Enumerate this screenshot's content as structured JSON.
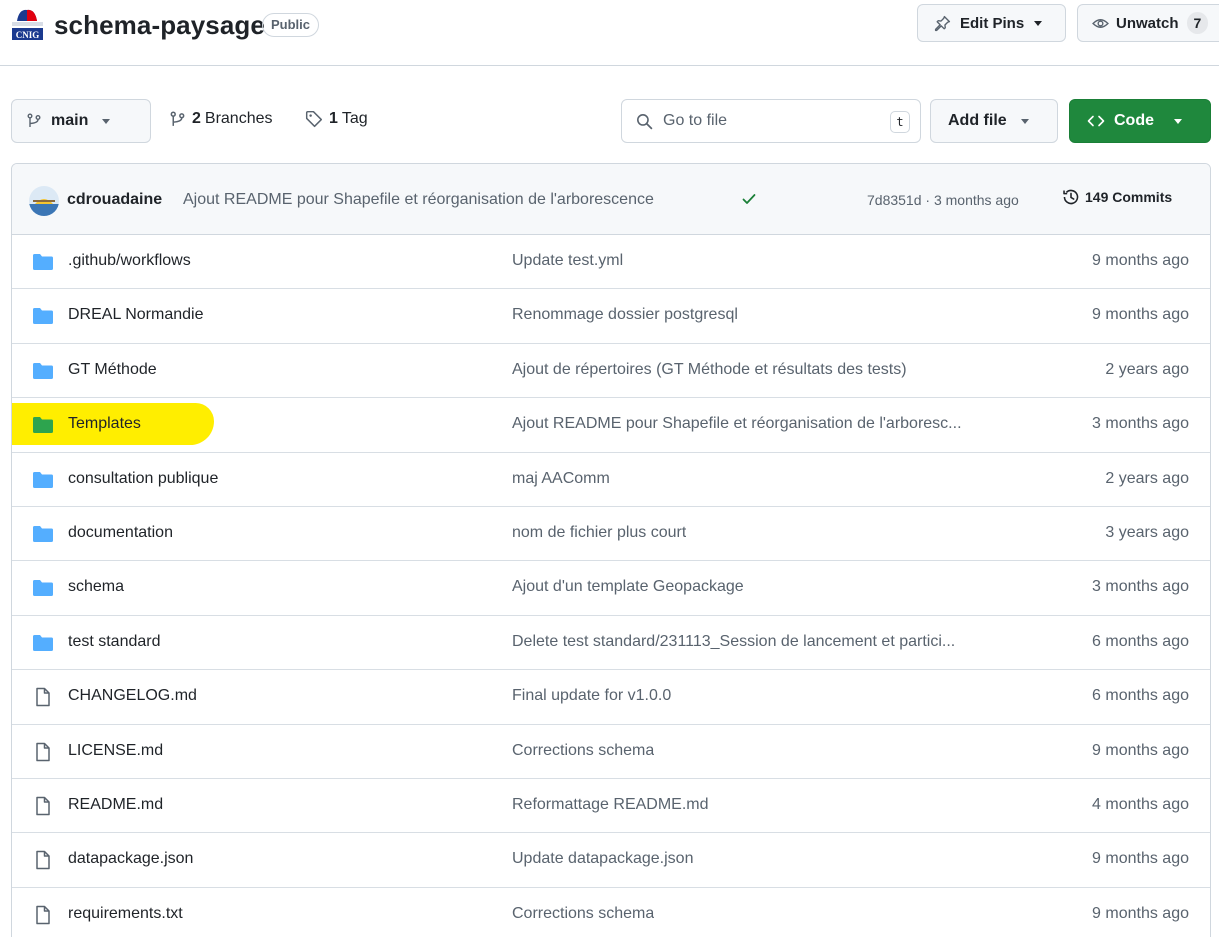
{
  "header": {
    "repo_name": "schema-paysage",
    "visibility": "Public",
    "edit_pins_label": "Edit Pins",
    "unwatch_label": "Unwatch",
    "watch_count": "7"
  },
  "toolbar": {
    "branch_name": "main",
    "branches_count": "2",
    "branches_label": "Branches",
    "tags_count": "1",
    "tags_label": "Tag",
    "search_placeholder": "Go to file",
    "search_shortcut": "t",
    "add_file_label": "Add file",
    "code_label": "Code"
  },
  "commit": {
    "author": "cdrouadaine",
    "message": "Ajout README pour Shapefile et réorganisation de l'arborescence",
    "sha_time": "7d8351d · 3 months ago",
    "commits_count": "149 Commits"
  },
  "colors": {
    "folder": "#54aeff",
    "folder_highlighted": "#2da44e",
    "highlight": "#ffee00",
    "primary_button": "#1f883d"
  },
  "files": [
    {
      "name": ".github/workflows",
      "type": "folder",
      "message": "Update test.yml",
      "age": "9 months ago"
    },
    {
      "name": "DREAL Normandie",
      "type": "folder",
      "message": "Renommage dossier postgresql",
      "age": "9 months ago"
    },
    {
      "name": "GT Méthode",
      "type": "folder",
      "message": "Ajout de répertoires (GT Méthode et résultats des tests)",
      "age": "2 years ago"
    },
    {
      "name": "Templates",
      "type": "folder",
      "highlighted": true,
      "message": "Ajout README pour Shapefile et réorganisation de l'arboresc...",
      "age": "3 months ago"
    },
    {
      "name": "consultation publique",
      "type": "folder",
      "message": "maj AAComm",
      "age": "2 years ago"
    },
    {
      "name": "documentation",
      "type": "folder",
      "message": "nom de fichier plus court",
      "age": "3 years ago"
    },
    {
      "name": "schema",
      "type": "folder",
      "message": "Ajout d'un template Geopackage",
      "age": "3 months ago"
    },
    {
      "name": "test standard",
      "type": "folder",
      "message": "Delete test standard/231113_Session de lancement et partici...",
      "age": "6 months ago"
    },
    {
      "name": "CHANGELOG.md",
      "type": "file",
      "message": "Final update for v1.0.0",
      "age": "6 months ago"
    },
    {
      "name": "LICENSE.md",
      "type": "file",
      "message": "Corrections schema",
      "age": "9 months ago"
    },
    {
      "name": "README.md",
      "type": "file",
      "message": "Reformattage README.md",
      "age": "4 months ago"
    },
    {
      "name": "datapackage.json",
      "type": "file",
      "message": "Update datapackage.json",
      "age": "9 months ago"
    },
    {
      "name": "requirements.txt",
      "type": "file",
      "message": "Corrections schema",
      "age": "9 months ago"
    }
  ]
}
